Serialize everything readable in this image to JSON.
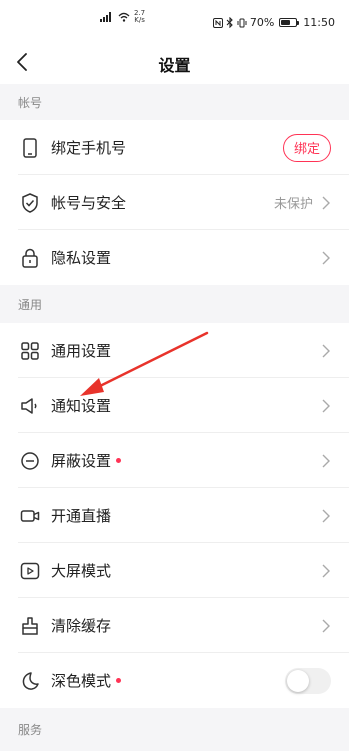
{
  "status_bar": {
    "network_speed_value": "2.7",
    "network_speed_unit": "K/s",
    "battery": "70%",
    "battery_level": 0.7,
    "time": "11:50"
  },
  "header": {
    "title": "设置"
  },
  "sections": {
    "account": {
      "title": "帐号",
      "items": [
        {
          "label": "绑定手机号",
          "icon": "phone-icon",
          "button": "绑定"
        },
        {
          "label": "帐号与安全",
          "icon": "shield-icon",
          "value": "未保护"
        },
        {
          "label": "隐私设置",
          "icon": "lock-icon"
        }
      ]
    },
    "general": {
      "title": "通用",
      "items": [
        {
          "label": "通用设置",
          "icon": "grid-icon"
        },
        {
          "label": "通知设置",
          "icon": "speaker-icon"
        },
        {
          "label": "屏蔽设置",
          "icon": "block-icon",
          "dot": true
        },
        {
          "label": "开通直播",
          "icon": "camera-icon"
        },
        {
          "label": "大屏模式",
          "icon": "play-screen-icon"
        },
        {
          "label": "清除缓存",
          "icon": "broom-icon"
        },
        {
          "label": "深色模式",
          "icon": "moon-icon",
          "dot": true,
          "toggle": false
        }
      ]
    },
    "service": {
      "title": "服务"
    }
  },
  "colors": {
    "accent": "#ff3355",
    "section_bg": "#f5f5f7",
    "annotation_arrow": "#e8332b"
  }
}
